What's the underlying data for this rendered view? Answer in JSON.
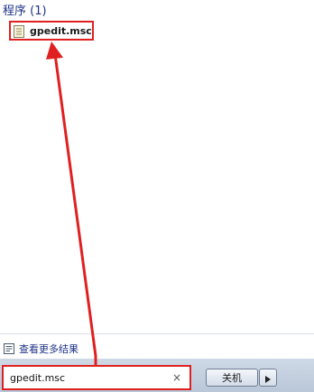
{
  "results": {
    "section_label": "程序 (1)",
    "items": [
      {
        "label": "gpedit.msc",
        "icon": "msc-file-icon"
      }
    ]
  },
  "see_more": {
    "label": "查看更多结果",
    "icon": "search-results-icon"
  },
  "search": {
    "value": "gpedit.msc",
    "clear_label": "×"
  },
  "shutdown": {
    "label": "关机",
    "arrow_icon": "arrow-right-icon"
  },
  "colors": {
    "annotation": "#e02020",
    "link": "#1e3287"
  }
}
